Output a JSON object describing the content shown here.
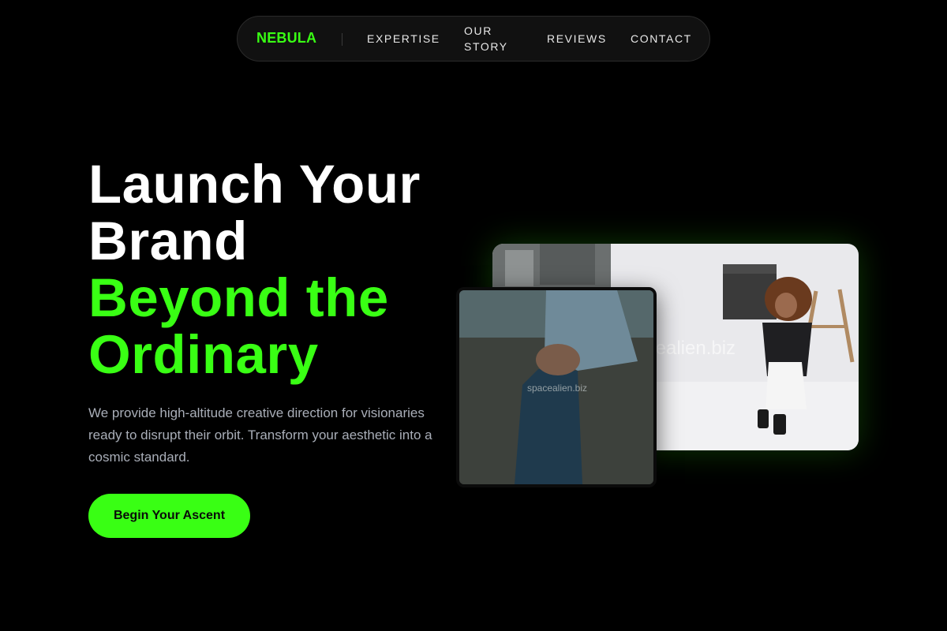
{
  "nav": {
    "brand": "NEBULA",
    "links": [
      {
        "label": "EXPERTISE"
      },
      {
        "label": "OUR STORY"
      },
      {
        "label": "REVIEWS"
      },
      {
        "label": "CONTACT"
      }
    ]
  },
  "hero": {
    "title_line1": "Launch Your",
    "title_line2": "Brand",
    "title_line3": "Beyond the",
    "title_line4": "Ordinary",
    "description": "We provide high-altitude creative direction for visionaries ready to disrupt their orbit. Transform your aesthetic into a cosmic standard.",
    "cta_label": "Begin Your Ascent"
  },
  "images": {
    "back_watermark": "spacealien.biz",
    "front_watermark": "spacealien.biz"
  },
  "colors": {
    "accent": "#39ff14",
    "background": "#000000",
    "text": "#ffffff",
    "muted": "#a9aeb8"
  }
}
